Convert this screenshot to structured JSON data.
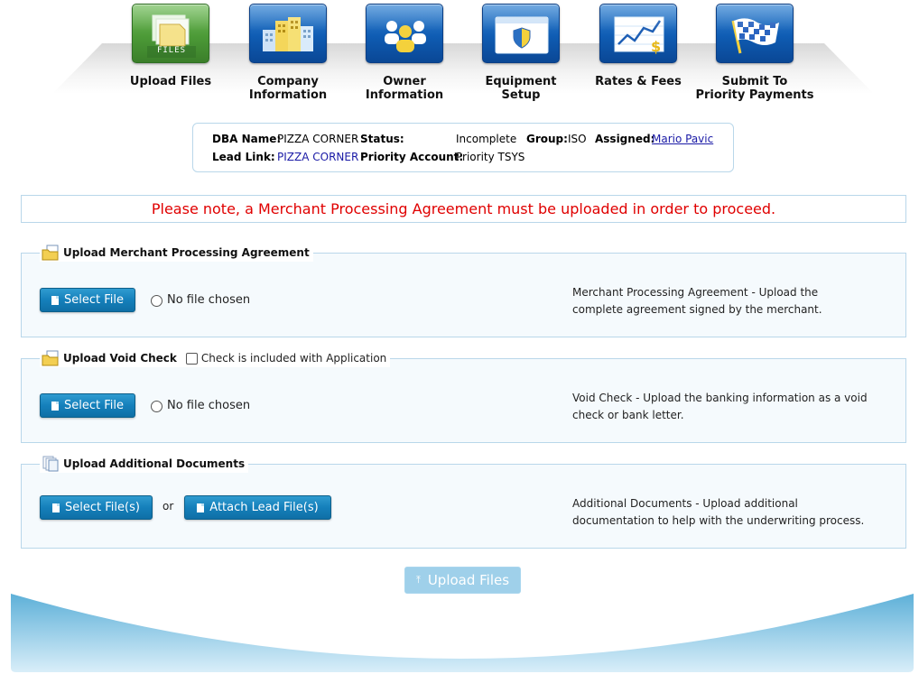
{
  "steps": [
    {
      "label": "Upload Files",
      "icon": "files-folder-icon",
      "badge": "FILES",
      "active": true
    },
    {
      "label": "Company\nInformation",
      "icon": "buildings-icon",
      "active": false
    },
    {
      "label": "Owner\nInformation",
      "icon": "people-icon",
      "active": false
    },
    {
      "label": "Equipment\nSetup",
      "icon": "secure-window-icon",
      "active": false
    },
    {
      "label": "Rates & Fees",
      "icon": "rate-chart-icon",
      "active": false
    },
    {
      "label": "Submit To\nPriority Payments",
      "icon": "checkered-flag-icon",
      "active": false
    }
  ],
  "info": {
    "dba_label": "DBA Name:",
    "dba_value": "PIZZA CORNER",
    "status_label": "Status:",
    "status_value": "Incomplete",
    "group_label": "Group:",
    "group_value": "ISO",
    "assigned_label": "Assigned:",
    "assigned_value": "Mario Pavic",
    "lead_label": "Lead Link:",
    "lead_value": "PIZZA CORNER",
    "account_label": "Priority Account:",
    "account_value": "Priority TSYS"
  },
  "notice": "Please note, a Merchant Processing Agreement must be uploaded in order to proceed.",
  "sections": {
    "mpa": {
      "title": "Upload Merchant Processing Agreement",
      "button": "Select File",
      "file_status": "No file chosen",
      "description": "Merchant Processing Agreement - Upload the complete agreement signed by the merchant."
    },
    "void": {
      "title": "Upload Void Check",
      "checkbox_label": "Check is included with Application",
      "button": "Select File",
      "file_status": "No file chosen",
      "description": "Void Check - Upload the banking information as a void check or bank letter."
    },
    "additional": {
      "title": "Upload Additional Documents",
      "button": "Select File(s)",
      "or_text": "or",
      "attach_button": "Attach Lead File(s)",
      "description": "Additional Documents - Upload additional documentation to help with the underwriting process."
    }
  },
  "upload_all": "Upload Files",
  "colors": {
    "notice_text": "#e00000",
    "button_blue": "#1580bb",
    "active_step": "#4c9a37",
    "step_blue": "#0f5cb3",
    "panel_border": "#b9d7ea"
  }
}
